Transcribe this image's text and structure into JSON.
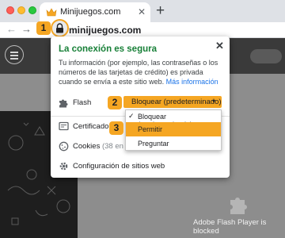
{
  "browser": {
    "tab_title": "Minijuegos.com",
    "tab_close": "✕",
    "new_tab": "+",
    "nav_back": "←",
    "nav_forward": "→",
    "url": "minijuegos.com"
  },
  "badges": [
    "1",
    "2",
    "3"
  ],
  "popup": {
    "title": "La conexión es segura",
    "close": "✕",
    "description": "Tu información (por ejemplo, las contraseñas o los números de las tarjetas de crédito) es privada cuando se envía a este sitio web.",
    "more_info": "Más información",
    "flash": {
      "label": "Flash",
      "value": "Bloquear (predeterminado)",
      "caret": "▾"
    },
    "certificate_label": "Certificado (v",
    "cookies_label": "Cookies",
    "cookies_count": "(38 en uso)",
    "site_settings_label": "Configuración de sitios web"
  },
  "dropdown": {
    "check": "✓",
    "options": [
      "Bloquear (predeterminado)",
      "Permitir",
      "Preguntar"
    ],
    "selected_index": 1
  },
  "site": {
    "flash_blocked_text": "Adobe Flash Player is blocked"
  },
  "colors": {
    "highlight": "#f5a623",
    "secure_green": "#188038",
    "link_blue": "#1a73e8"
  },
  "icons": [
    "crown-icon",
    "lock-icon",
    "flash-puzzle-icon",
    "certificate-icon",
    "cookie-icon",
    "gear-icon",
    "plugin-puzzle-icon",
    "hamburger-icon"
  ]
}
